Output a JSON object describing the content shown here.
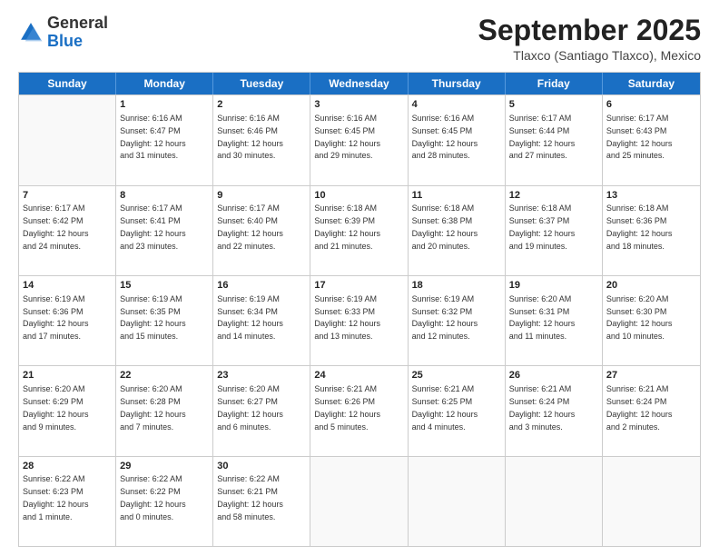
{
  "logo": {
    "general": "General",
    "blue": "Blue"
  },
  "title": "September 2025",
  "location": "Tlaxco (Santiago Tlaxco), Mexico",
  "days": [
    "Sunday",
    "Monday",
    "Tuesday",
    "Wednesday",
    "Thursday",
    "Friday",
    "Saturday"
  ],
  "weeks": [
    [
      {
        "num": "",
        "empty": true
      },
      {
        "num": "1",
        "rise": "6:16 AM",
        "set": "6:47 PM",
        "daylight": "12 hours and 31 minutes."
      },
      {
        "num": "2",
        "rise": "6:16 AM",
        "set": "6:46 PM",
        "daylight": "12 hours and 30 minutes."
      },
      {
        "num": "3",
        "rise": "6:16 AM",
        "set": "6:45 PM",
        "daylight": "12 hours and 29 minutes."
      },
      {
        "num": "4",
        "rise": "6:16 AM",
        "set": "6:45 PM",
        "daylight": "12 hours and 28 minutes."
      },
      {
        "num": "5",
        "rise": "6:17 AM",
        "set": "6:44 PM",
        "daylight": "12 hours and 27 minutes."
      },
      {
        "num": "6",
        "rise": "6:17 AM",
        "set": "6:43 PM",
        "daylight": "12 hours and 25 minutes."
      }
    ],
    [
      {
        "num": "7",
        "rise": "6:17 AM",
        "set": "6:42 PM",
        "daylight": "12 hours and 24 minutes."
      },
      {
        "num": "8",
        "rise": "6:17 AM",
        "set": "6:41 PM",
        "daylight": "12 hours and 23 minutes."
      },
      {
        "num": "9",
        "rise": "6:17 AM",
        "set": "6:40 PM",
        "daylight": "12 hours and 22 minutes."
      },
      {
        "num": "10",
        "rise": "6:18 AM",
        "set": "6:39 PM",
        "daylight": "12 hours and 21 minutes."
      },
      {
        "num": "11",
        "rise": "6:18 AM",
        "set": "6:38 PM",
        "daylight": "12 hours and 20 minutes."
      },
      {
        "num": "12",
        "rise": "6:18 AM",
        "set": "6:37 PM",
        "daylight": "12 hours and 19 minutes."
      },
      {
        "num": "13",
        "rise": "6:18 AM",
        "set": "6:36 PM",
        "daylight": "12 hours and 18 minutes."
      }
    ],
    [
      {
        "num": "14",
        "rise": "6:19 AM",
        "set": "6:36 PM",
        "daylight": "12 hours and 17 minutes."
      },
      {
        "num": "15",
        "rise": "6:19 AM",
        "set": "6:35 PM",
        "daylight": "12 hours and 15 minutes."
      },
      {
        "num": "16",
        "rise": "6:19 AM",
        "set": "6:34 PM",
        "daylight": "12 hours and 14 minutes."
      },
      {
        "num": "17",
        "rise": "6:19 AM",
        "set": "6:33 PM",
        "daylight": "12 hours and 13 minutes."
      },
      {
        "num": "18",
        "rise": "6:19 AM",
        "set": "6:32 PM",
        "daylight": "12 hours and 12 minutes."
      },
      {
        "num": "19",
        "rise": "6:20 AM",
        "set": "6:31 PM",
        "daylight": "12 hours and 11 minutes."
      },
      {
        "num": "20",
        "rise": "6:20 AM",
        "set": "6:30 PM",
        "daylight": "12 hours and 10 minutes."
      }
    ],
    [
      {
        "num": "21",
        "rise": "6:20 AM",
        "set": "6:29 PM",
        "daylight": "12 hours and 9 minutes."
      },
      {
        "num": "22",
        "rise": "6:20 AM",
        "set": "6:28 PM",
        "daylight": "12 hours and 7 minutes."
      },
      {
        "num": "23",
        "rise": "6:20 AM",
        "set": "6:27 PM",
        "daylight": "12 hours and 6 minutes."
      },
      {
        "num": "24",
        "rise": "6:21 AM",
        "set": "6:26 PM",
        "daylight": "12 hours and 5 minutes."
      },
      {
        "num": "25",
        "rise": "6:21 AM",
        "set": "6:25 PM",
        "daylight": "12 hours and 4 minutes."
      },
      {
        "num": "26",
        "rise": "6:21 AM",
        "set": "6:24 PM",
        "daylight": "12 hours and 3 minutes."
      },
      {
        "num": "27",
        "rise": "6:21 AM",
        "set": "6:24 PM",
        "daylight": "12 hours and 2 minutes."
      }
    ],
    [
      {
        "num": "28",
        "rise": "6:22 AM",
        "set": "6:23 PM",
        "daylight": "12 hours and 1 minute."
      },
      {
        "num": "29",
        "rise": "6:22 AM",
        "set": "6:22 PM",
        "daylight": "12 hours and 0 minutes."
      },
      {
        "num": "30",
        "rise": "6:22 AM",
        "set": "6:21 PM",
        "daylight": "11 hours and 58 minutes."
      },
      {
        "num": "",
        "empty": true
      },
      {
        "num": "",
        "empty": true
      },
      {
        "num": "",
        "empty": true
      },
      {
        "num": "",
        "empty": true
      }
    ]
  ],
  "labels": {
    "sunrise": "Sunrise:",
    "sunset": "Sunset:",
    "daylight": "Daylight:"
  }
}
